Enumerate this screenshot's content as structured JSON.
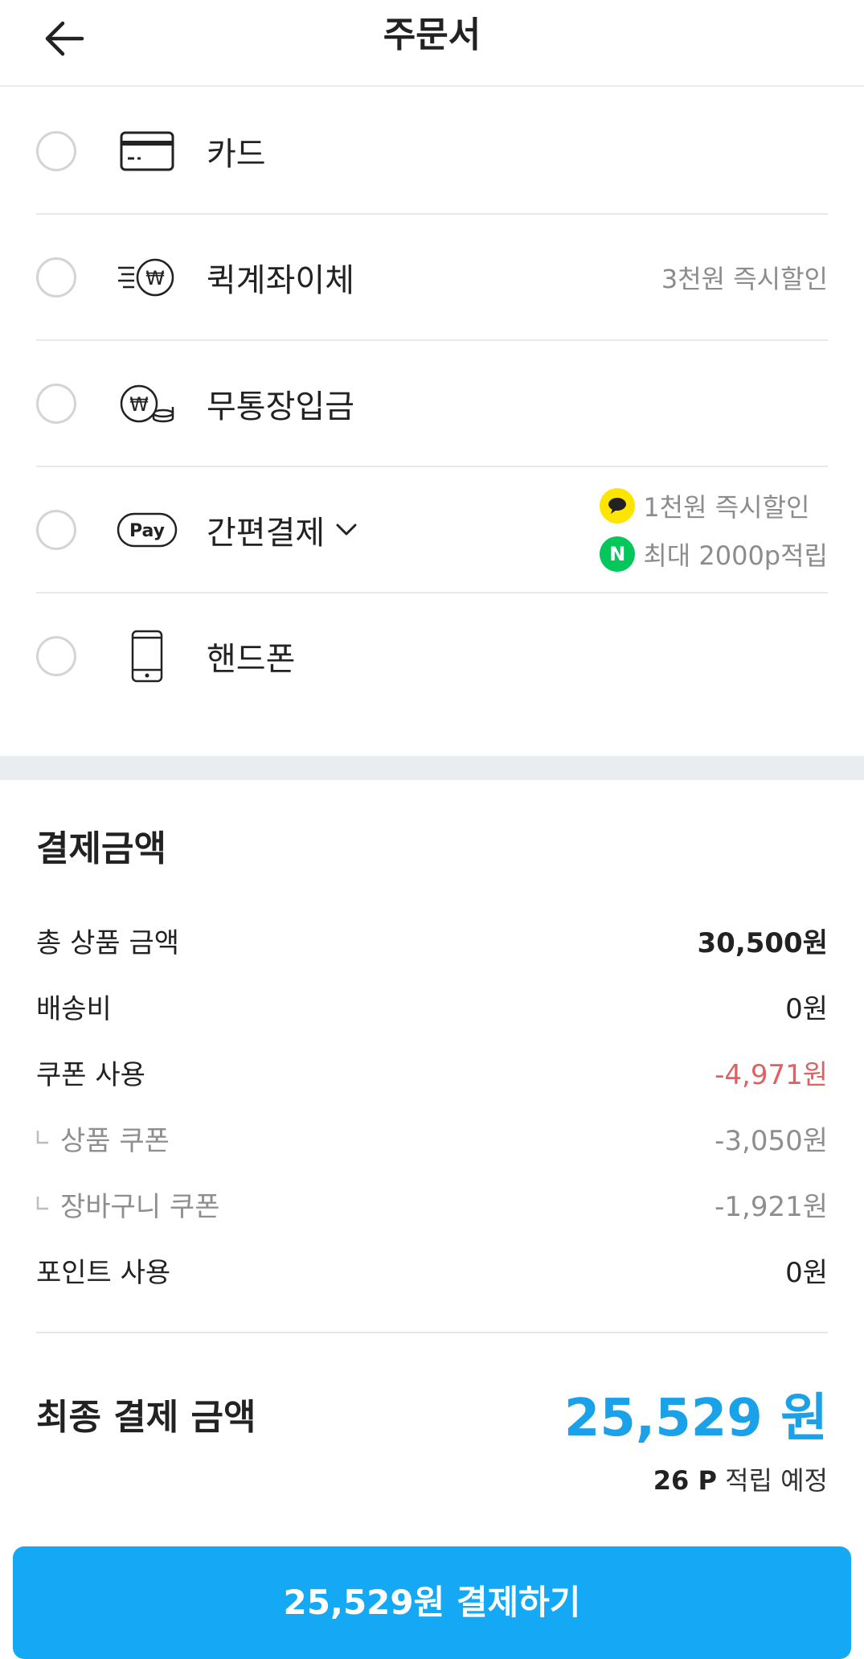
{
  "header": {
    "title": "주문서",
    "back_icon": "arrow-left-icon"
  },
  "payment_methods": [
    {
      "label": "카드",
      "icon": "credit-card-icon",
      "note": ""
    },
    {
      "label": "퀵계좌이체",
      "icon": "fast-won-transfer-icon",
      "note": "3천원 즉시할인"
    },
    {
      "label": "무통장입금",
      "icon": "won-coins-icon",
      "note": ""
    },
    {
      "label": "간편결제",
      "icon": "pay-icon",
      "pay_icon_text": "Pay",
      "promos": [
        {
          "icon": "kakao-icon",
          "text": "1천원 즉시할인"
        },
        {
          "icon": "naver-icon",
          "badge_text": "N",
          "text": "최대 2000p적립"
        }
      ]
    },
    {
      "label": "핸드폰",
      "icon": "mobile-phone-icon",
      "note": ""
    }
  ],
  "summary": {
    "title": "결제금액",
    "lines": [
      {
        "label": "총 상품 금액",
        "value": "30,500원",
        "style": "bold"
      },
      {
        "label": "배송비",
        "value": "0원",
        "style": "normal"
      },
      {
        "label": "쿠폰 사용",
        "value": "-4,971원",
        "style": "red"
      },
      {
        "label": "상품 쿠폰",
        "value": "-3,050원",
        "style": "sub"
      },
      {
        "label": "장바구니 쿠폰",
        "value": "-1,921원",
        "style": "sub"
      },
      {
        "label": "포인트 사용",
        "value": "0원",
        "style": "normal"
      }
    ],
    "final_label": "최종 결제 금액",
    "final_amount": "25,529 원",
    "points_value": "26 P",
    "points_suffix": "적립 예정"
  },
  "pay_button": {
    "label": "25,529원 결제하기"
  },
  "colors": {
    "accent": "#1aa1e8",
    "button": "#14a8f5",
    "discount": "#e06161",
    "kakao": "#fee500",
    "naver": "#03c75a"
  }
}
